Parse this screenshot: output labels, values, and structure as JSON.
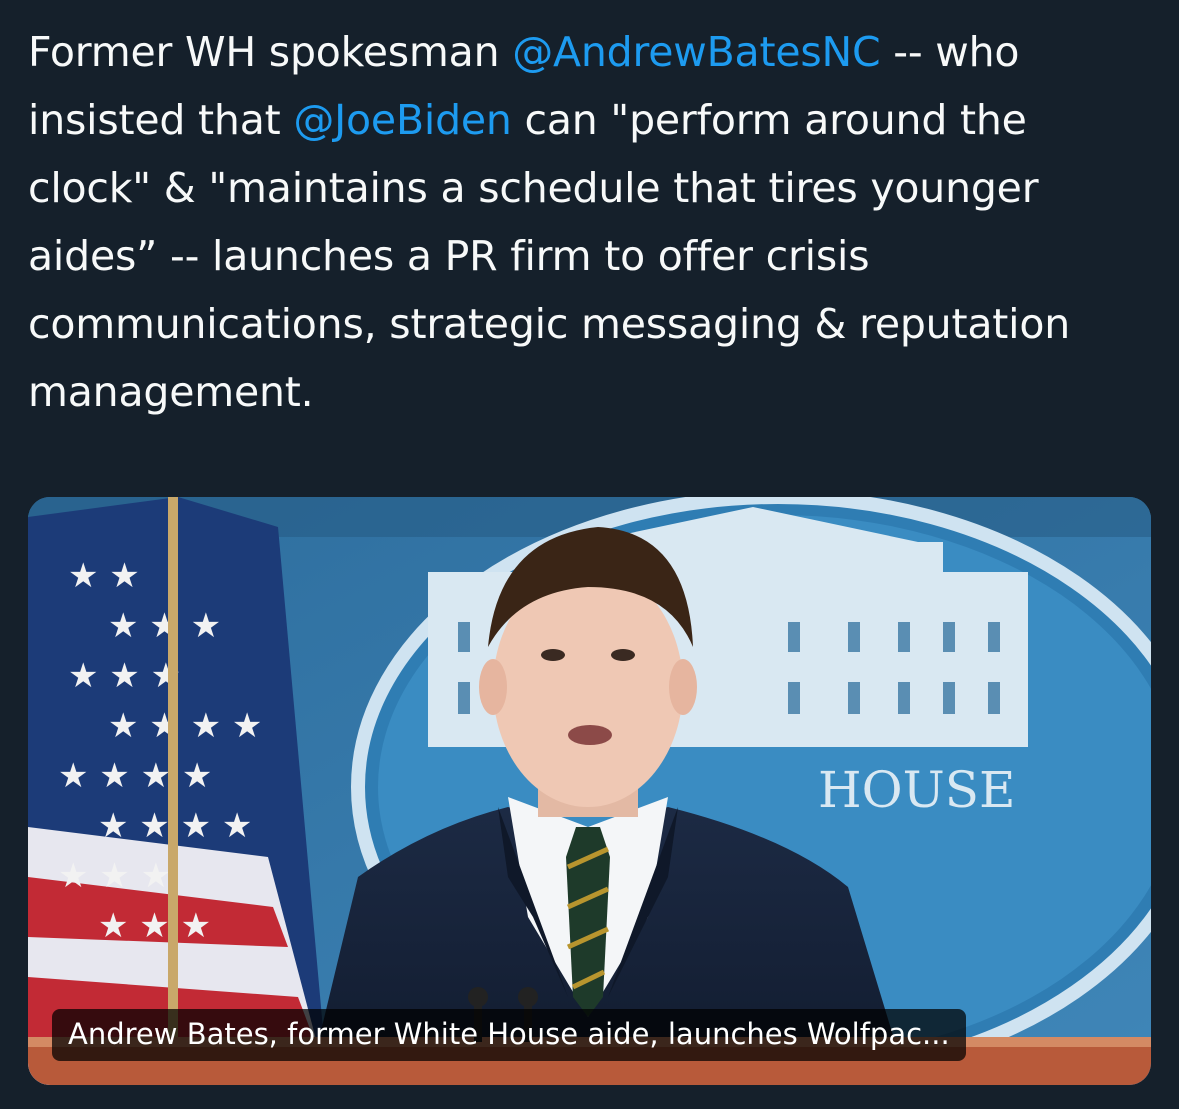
{
  "tweet": {
    "segments": {
      "s1": "Former WH spokesman ",
      "m1": "@AndrewBatesNC",
      "s2": " -- who insisted that ",
      "m2": "@JoeBiden",
      "s3": " can \"perform around the clock\" & \"maintains a schedule that tires younger aides” -- launches a PR firm to offer crisis communications, strategic messaging & reputation management."
    }
  },
  "card": {
    "image_alt": "Andrew Bates at White House press briefing podium",
    "caption": "Andrew Bates, former White House aide, launches Wolfpac...",
    "seal_text": "HOUSE"
  },
  "colors": {
    "background": "#15202b",
    "text": "#f7f9f9",
    "mention": "#1d9bf0"
  }
}
